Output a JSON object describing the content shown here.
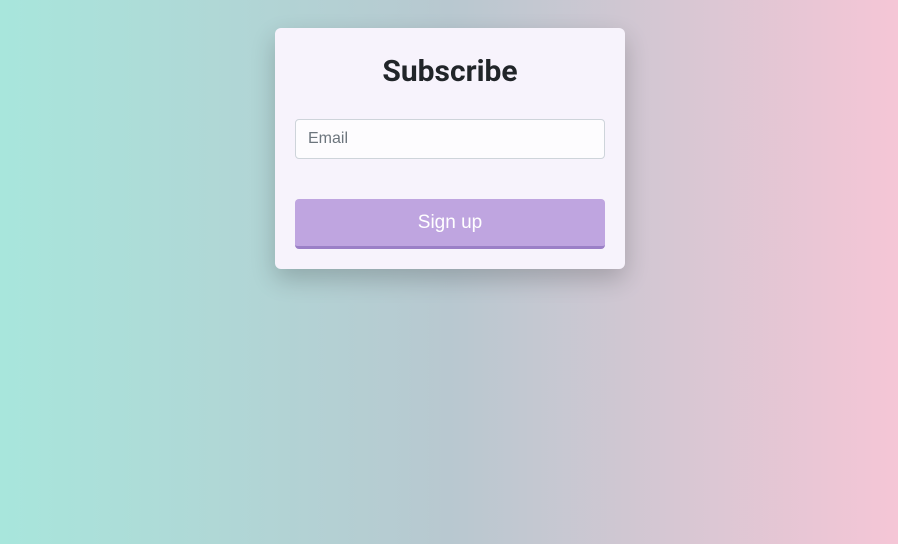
{
  "card": {
    "title": "Subscribe",
    "email_placeholder": "Email",
    "email_value": "",
    "signup_label": "Sign up"
  }
}
